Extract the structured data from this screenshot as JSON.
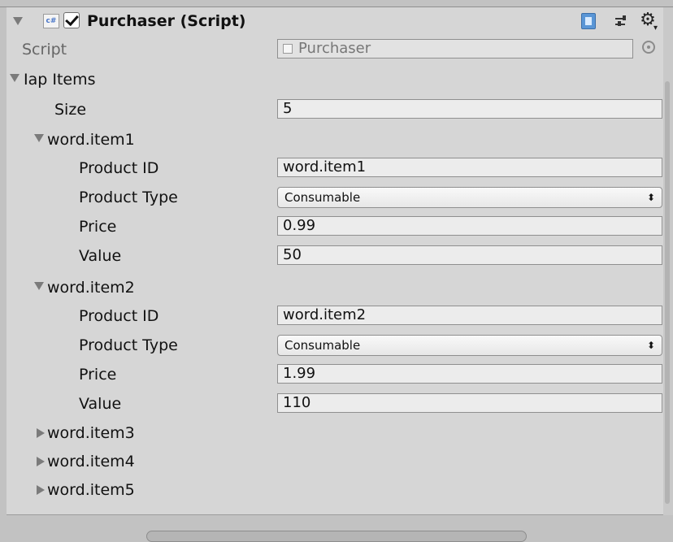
{
  "component": {
    "title": "Purchaser (Script)",
    "icons": {
      "collapse": "triangle-down",
      "script_type": "csharp-script-icon",
      "enabled": "checkbox-checked",
      "help": "book-icon",
      "presets": "sliders-icon",
      "settings": "gear-icon"
    }
  },
  "script_row": {
    "label": "Script",
    "value": "Purchaser"
  },
  "iap_items": {
    "label": "Iap Items",
    "size_label": "Size",
    "size_value": "5",
    "items": [
      {
        "name": "word.item1",
        "expanded": true,
        "fields": {
          "product_id_label": "Product ID",
          "product_id_value": "word.item1",
          "product_type_label": "Product Type",
          "product_type_value": "Consumable",
          "price_label": "Price",
          "price_value": "0.99",
          "value_label": "Value",
          "value_value": "50"
        }
      },
      {
        "name": "word.item2",
        "expanded": true,
        "fields": {
          "product_id_label": "Product ID",
          "product_id_value": "word.item2",
          "product_type_label": "Product Type",
          "product_type_value": "Consumable",
          "price_label": "Price",
          "price_value": "1.99",
          "value_label": "Value",
          "value_value": "110"
        }
      },
      {
        "name": "word.item3",
        "expanded": false
      },
      {
        "name": "word.item4",
        "expanded": false
      },
      {
        "name": "word.item5",
        "expanded": false
      }
    ]
  },
  "glyphs": {
    "csharp": "c#",
    "dropdown_arrows": "⬍",
    "gear": "⚙",
    "caret": "▾"
  }
}
